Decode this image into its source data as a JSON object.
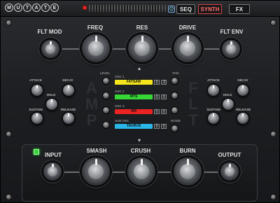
{
  "header": {
    "logo_letters": [
      "M",
      "U",
      "T",
      "A",
      "T",
      "E"
    ],
    "tabs": [
      {
        "label": "SEQ",
        "active": false
      },
      {
        "label": "SYNTH",
        "active": true
      },
      {
        "label": "FX",
        "active": false
      }
    ]
  },
  "synth": {
    "top_knobs": {
      "flt_mod": "FLT MOD",
      "freq": "FREQ",
      "res": "RES",
      "drive": "DRIVE",
      "flt_env": "FLT ENV"
    },
    "amp_env": {
      "attack": "ATTACK",
      "decay": "DECAY",
      "hold": "HOLD",
      "sustain": "SUSTAIN",
      "release": "RELEASE"
    },
    "flt_env_section": {
      "attack": "ATTACK",
      "decay": "DECAY",
      "hold": "HOLD",
      "sustain": "SUSTAIN",
      "release": "RELEASE"
    },
    "amp_letters": [
      "A",
      "M",
      "P"
    ],
    "flt_letters": [
      "F",
      "L",
      "T"
    ],
    "level_label": "LEVEL",
    "pan_label": "PAN",
    "noise_label": "NOISE",
    "oscillators": [
      {
        "label": "OSC 1",
        "wave": "FATSAW",
        "color": "#f3e41b",
        "v1": "6",
        "v2": "-2"
      },
      {
        "label": "OSC 2",
        "wave": "MTS",
        "color": "#36d636",
        "v1": "0",
        "v2": "0"
      },
      {
        "label": "OSC 3",
        "wave": "405",
        "color": "#ec2323",
        "v1": "0",
        "v2": "0"
      },
      {
        "label": "SUB OSC",
        "wave": "TAURUS",
        "color": "#2ab6e6",
        "v1": "0",
        "v2": "0"
      }
    ]
  },
  "fx": {
    "input": "INPUT",
    "smash": "SMASH",
    "crush": "CRUSH",
    "burn": "BURN",
    "output": "OUTPUT"
  }
}
